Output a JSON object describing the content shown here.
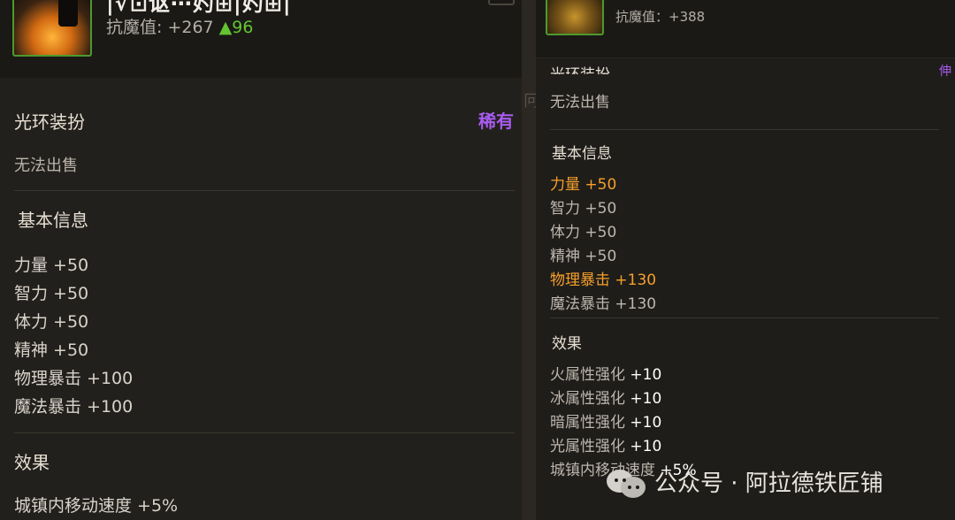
{
  "left": {
    "title_fragment": "|√⊡讴⋯妁⊞|妁⊞|",
    "resist_label": "抗魔值: +267",
    "resist_delta": "▲96",
    "slot_name": "光环装扮",
    "rarity": "稀有",
    "trade": "无法出售",
    "basic_info_label": "基本信息",
    "stats": [
      "力量 +50",
      "智力 +50",
      "体力 +50",
      "精神 +50",
      "物理暴击 +100",
      "魔法暴击 +100"
    ],
    "effects_label": "效果",
    "effects": [
      "城镇内移动速度 +5%"
    ]
  },
  "gap_text": "冋层",
  "right": {
    "resist_label": "抗魔值：+388",
    "slot_name_cut": "光环装扮",
    "rarity_cut": "伸",
    "trade": "无法出售",
    "basic_info_label": "基本信息",
    "stats": [
      {
        "label": "力量",
        "value": "+50",
        "highlight": true
      },
      {
        "label": "智力",
        "value": "+50",
        "highlight": false
      },
      {
        "label": "体力",
        "value": "+50",
        "highlight": false
      },
      {
        "label": "精神",
        "value": "+50",
        "highlight": false
      },
      {
        "label": "物理暴击",
        "value": "+130",
        "highlight": true
      },
      {
        "label": "魔法暴击",
        "value": "+130",
        "highlight": false
      }
    ],
    "effects_label": "效果",
    "effects": [
      {
        "label": "火属性强化",
        "value": "+10"
      },
      {
        "label": "冰属性强化",
        "value": "+10"
      },
      {
        "label": "暗属性强化",
        "value": "+10"
      },
      {
        "label": "光属性强化",
        "value": "+10"
      },
      {
        "label": "城镇内移动速度",
        "value": "+5%"
      }
    ]
  },
  "watermark": "公众号 · 阿拉德铁匠铺",
  "colors": {
    "rare": "#a85cf0",
    "highlight": "#f5a02a",
    "up": "#63c431",
    "icon_border": "#4c9a2e"
  }
}
